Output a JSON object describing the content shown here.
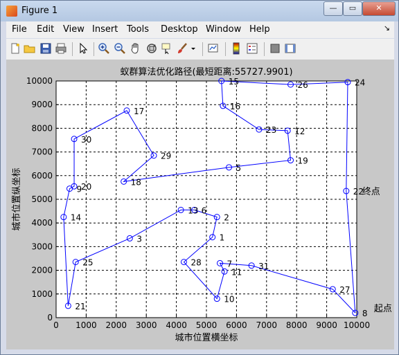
{
  "window": {
    "title": "Figure 1",
    "min_symbol": "—",
    "max_symbol": "▭",
    "close_symbol": "✕"
  },
  "menu": [
    "File",
    "Edit",
    "View",
    "Insert",
    "Tools",
    "Desktop",
    "Window",
    "Help"
  ],
  "menu_corner": "↘",
  "toolbar_icons": [
    "new-figure-icon",
    "open-file-icon",
    "save-icon",
    "print-icon",
    "arrow-pointer-icon",
    "zoom-in-icon",
    "zoom-out-icon",
    "pan-hand-icon",
    "rotate-3d-icon",
    "data-cursor-icon",
    "brush-icon",
    "brush-dropdown-icon",
    "link-plot-icon",
    "colorbar-icon",
    "legend-icon",
    "hide-plot-tools-icon",
    "show-plot-tools-icon"
  ],
  "chart_data": {
    "type": "line",
    "title": "蚁群算法优化路径(最短距离:55727.9901)",
    "xlabel": "城市位置横坐标",
    "ylabel": "城市位置纵坐标",
    "xlim": [
      0,
      10000
    ],
    "ylim": [
      0,
      10000
    ],
    "xticks": [
      0,
      1000,
      2000,
      3000,
      4000,
      5000,
      6000,
      7000,
      8000,
      9000,
      10000
    ],
    "yticks": [
      0,
      1000,
      2000,
      3000,
      4000,
      5000,
      6000,
      7000,
      8000,
      9000,
      10000
    ],
    "grid": true,
    "line_color": "#0000ff",
    "marker": "circle",
    "route": [
      {
        "label": "8",
        "x": 9950,
        "y": 200
      },
      {
        "label": "27",
        "x": 9200,
        "y": 1200
      },
      {
        "label": "31",
        "x": 6500,
        "y": 2200
      },
      {
        "label": "7",
        "x": 5450,
        "y": 2300
      },
      {
        "label": "11",
        "x": 5600,
        "y": 1950
      },
      {
        "label": "10",
        "x": 5350,
        "y": 800
      },
      {
        "label": "28",
        "x": 4250,
        "y": 2350
      },
      {
        "label": "1",
        "x": 5200,
        "y": 3400
      },
      {
        "label": "2",
        "x": 5350,
        "y": 4250
      },
      {
        "label": "6",
        "x": 4600,
        "y": 4550
      },
      {
        "label": "13",
        "x": 4150,
        "y": 4550
      },
      {
        "label": "3",
        "x": 2450,
        "y": 3350
      },
      {
        "label": "25",
        "x": 650,
        "y": 2350
      },
      {
        "label": "21",
        "x": 400,
        "y": 500
      },
      {
        "label": "14",
        "x": 250,
        "y": 4250
      },
      {
        "label": "9",
        "x": 450,
        "y": 5450
      },
      {
        "label": "20",
        "x": 600,
        "y": 5550
      },
      {
        "label": "30",
        "x": 600,
        "y": 7550
      },
      {
        "label": "17",
        "x": 2350,
        "y": 8750
      },
      {
        "label": "29",
        "x": 3250,
        "y": 6850
      },
      {
        "label": "18",
        "x": 2250,
        "y": 5750
      },
      {
        "label": "5",
        "x": 5750,
        "y": 6350
      },
      {
        "label": "19",
        "x": 7800,
        "y": 6650
      },
      {
        "label": "12",
        "x": 7700,
        "y": 7900
      },
      {
        "label": "23",
        "x": 6750,
        "y": 7950
      },
      {
        "label": "16",
        "x": 5550,
        "y": 8950
      },
      {
        "label": "15",
        "x": 5500,
        "y": 10000
      },
      {
        "label": "26",
        "x": 7800,
        "y": 9850
      },
      {
        "label": "24",
        "x": 9700,
        "y": 9950
      },
      {
        "label": "22",
        "x": 9650,
        "y": 5350
      }
    ],
    "annotations": [
      {
        "text": "终点",
        "near": "22"
      },
      {
        "text": "起点",
        "near": "8"
      }
    ]
  }
}
